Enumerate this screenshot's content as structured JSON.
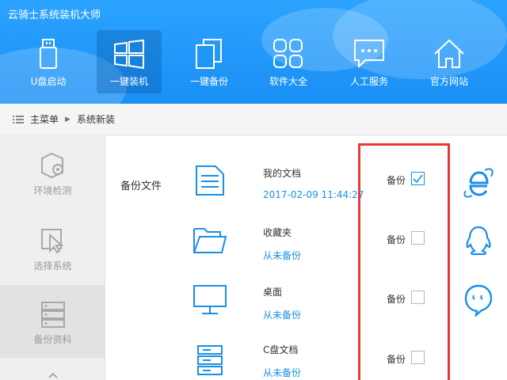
{
  "app": {
    "title": "云骑士系统装机大师"
  },
  "nav": [
    {
      "label": "U盘启动",
      "icon": "usb-drive-icon"
    },
    {
      "label": "一键装机",
      "icon": "windows-logo-icon",
      "active": true
    },
    {
      "label": "一键备份",
      "icon": "copy-files-icon"
    },
    {
      "label": "软件大全",
      "icon": "grid-apps-icon"
    },
    {
      "label": "人工服务",
      "icon": "chat-bubble-icon"
    },
    {
      "label": "官方网站",
      "icon": "home-icon"
    }
  ],
  "breadcrumb": {
    "root": "主菜单",
    "current": "系统新装",
    "menu_icon": "list-menu-icon",
    "sep_icon": "triangle-right-icon"
  },
  "sidebar": [
    {
      "label": "环境检测",
      "icon": "settings-box-icon"
    },
    {
      "label": "选择系统",
      "icon": "cursor-select-icon"
    },
    {
      "label": "备份资料",
      "icon": "server-stack-icon",
      "active": true
    }
  ],
  "content": {
    "section_title": "备份文件",
    "backup_label": "备份",
    "rows": [
      {
        "name": "我的文档",
        "sub": "2017-02-09 11:44:27",
        "icon": "document-icon",
        "checked": true
      },
      {
        "name": "收藏夹",
        "sub": "从未备份",
        "icon": "folder-icon",
        "checked": false
      },
      {
        "name": "桌面",
        "sub": "从未备份",
        "icon": "monitor-icon",
        "checked": false
      },
      {
        "name": "C盘文档",
        "sub": "从未备份",
        "icon": "server-icon",
        "checked": false
      }
    ],
    "side_apps": [
      {
        "icon": "ie-browser-icon"
      },
      {
        "icon": "qq-penguin-icon"
      },
      {
        "icon": "chat-app-icon"
      }
    ]
  },
  "colors": {
    "header": "#1a8ff5",
    "accent": "#1a8fe8",
    "highlight_box": "#e53935",
    "sidebar_bg": "#efefef"
  }
}
